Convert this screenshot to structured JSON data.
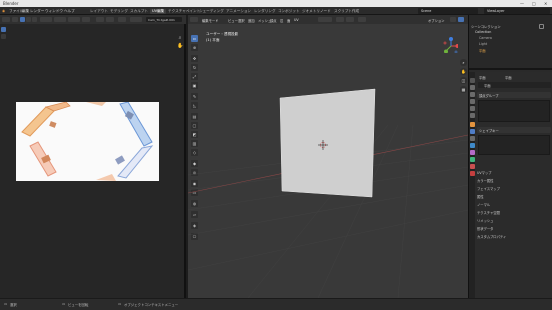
{
  "window": {
    "title": "Blender",
    "controls": [
      "—",
      "□",
      "✕"
    ]
  },
  "topbar": {
    "menus": [
      "ファイル",
      "編集",
      "レンダー",
      "ウィンドウ",
      "ヘルプ"
    ],
    "workspaces": [
      "レイアウト",
      "モデリング",
      "スカルプト",
      "UV編集",
      "テクスチャペイント",
      "シェーディング",
      "アニメーション",
      "レンダリング",
      "コンポジット",
      "ジオメトリノード",
      "スクリプト作成"
    ],
    "active_workspace": "UV編集",
    "scene": "Scene",
    "view_layer": "ViewLayer"
  },
  "image_editor": {
    "filename": "Cam_Tri.tga#.001"
  },
  "viewport": {
    "header_items": [
      "編集モード",
      "ビュー",
      "選択",
      "追加",
      "メッシュ",
      "頂点",
      "辺",
      "面",
      "UV"
    ],
    "overlay_line1": "ユーザー・透視投影",
    "overlay_line2": "(1) 平面",
    "options_label": "オプション"
  },
  "outliner": {
    "rows": [
      "シーンコレクション",
      "Collection",
      "Camera",
      "Light",
      "平面"
    ]
  },
  "properties": {
    "object_name": "平面",
    "tab_label": "平面",
    "data_name": "平面",
    "panels": [
      "頂点グループ",
      "シェイプキー",
      "UVマップ",
      "カラー属性",
      "フェイスマップ",
      "属性",
      "ノーマル",
      "テクスチャ空間",
      "リメッシュ",
      "形状データ",
      "カスタムプロパティ"
    ]
  },
  "statusbar": {
    "items": [
      "選択",
      "ビューを回転",
      "オブジェクトコンテキストメニュー"
    ]
  },
  "colors": {
    "accent": "#4772b3",
    "background": "#393939",
    "panel": "#2b2b2b"
  }
}
